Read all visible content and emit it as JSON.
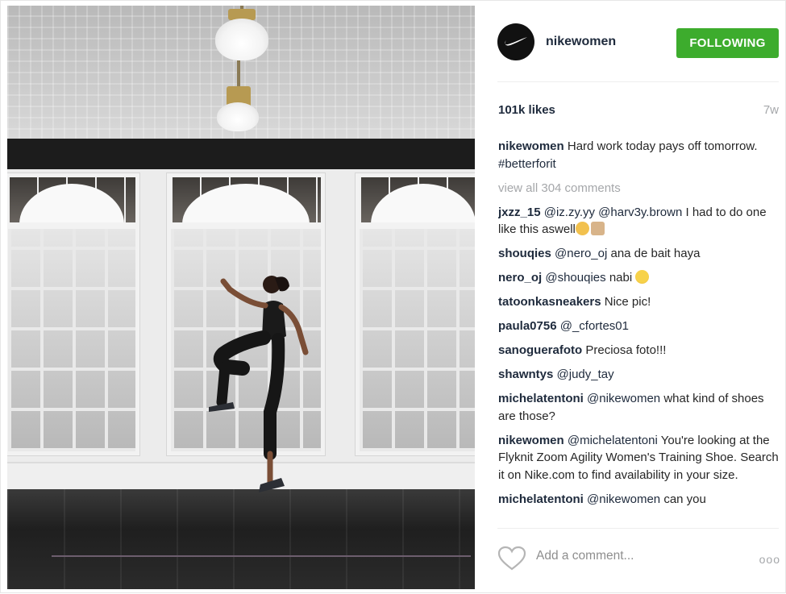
{
  "post": {
    "username": "nikewomen",
    "follow_label": "FOLLOWING",
    "likes": "101k likes",
    "age": "7w",
    "caption": {
      "user": "nikewomen",
      "text": "Hard work today pays off tomorrow.",
      "hashtag": "#betterforit"
    },
    "view_all": "view all 304 comments",
    "comments": [
      {
        "user": "jxzz_15",
        "mentions": "@iz.zy.yy @harv3y.brown",
        "text": "I had to do one like this aswell"
      },
      {
        "user": "shouqies",
        "mentions": "@nero_oj",
        "text": "ana de bait haya"
      },
      {
        "user": "nero_oj",
        "mentions": "@shouqies",
        "text": "nabi"
      },
      {
        "user": "tatoonkasneakers",
        "mentions": "",
        "text": "Nice pic!"
      },
      {
        "user": "paula0756",
        "mentions": "@_cfortes01",
        "text": ""
      },
      {
        "user": "sanoguerafoto",
        "mentions": "",
        "text": "Preciosa foto!!!"
      },
      {
        "user": "shawntys",
        "mentions": "@judy_tay",
        "text": ""
      },
      {
        "user": "michelatentoni",
        "mentions": "@nikewomen",
        "text": "what kind of shoes are those?"
      },
      {
        "user": "nikewomen",
        "mentions": "@michelatentoni",
        "text": "You're looking at the Flyknit Zoom Agility Women's Training Shoe. Search it on Nike.com to find availability in your size."
      },
      {
        "user": "michelatentoni",
        "mentions": "@nikewomen",
        "text": "can you"
      }
    ],
    "add_comment_placeholder": "Add a comment...",
    "more_label": "ooo"
  },
  "colors": {
    "follow_green": "#3dac2d",
    "username_navy": "#1e2a3c",
    "muted_gray": "#a5a7aa"
  },
  "icons": [
    "nike-swoosh-icon",
    "heart-icon",
    "more-options-icon",
    "clap-emoji-icon",
    "laughing-emoji-icon"
  ]
}
